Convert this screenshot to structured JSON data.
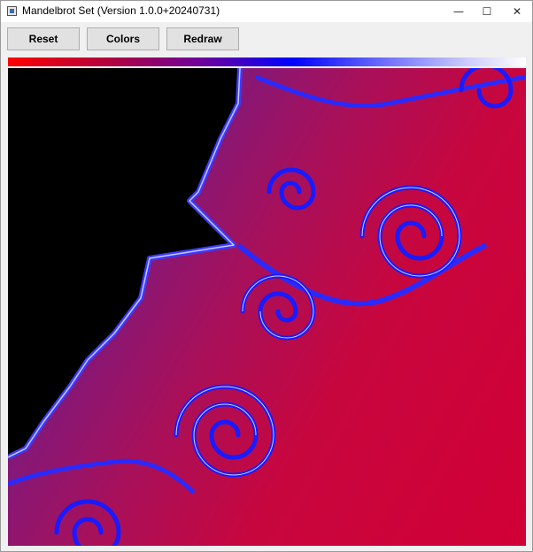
{
  "window": {
    "title": "Mandelbrot Set  (Version 1.0.0+20240731)",
    "controls": {
      "minimize": "—",
      "maximize": "☐",
      "close": "✕"
    }
  },
  "toolbar": {
    "reset_label": "Reset",
    "colors_label": "Colors",
    "redraw_label": "Redraw"
  },
  "palette": {
    "stops": [
      "#ff0000",
      "#b00040",
      "#6a00a0",
      "#0000ff",
      "#6a6aff",
      "#c8c8ff",
      "#ffffff"
    ]
  },
  "canvas": {
    "set_color": "#000000",
    "background_color": "#d10035",
    "filament_color": "#1a1aff"
  }
}
